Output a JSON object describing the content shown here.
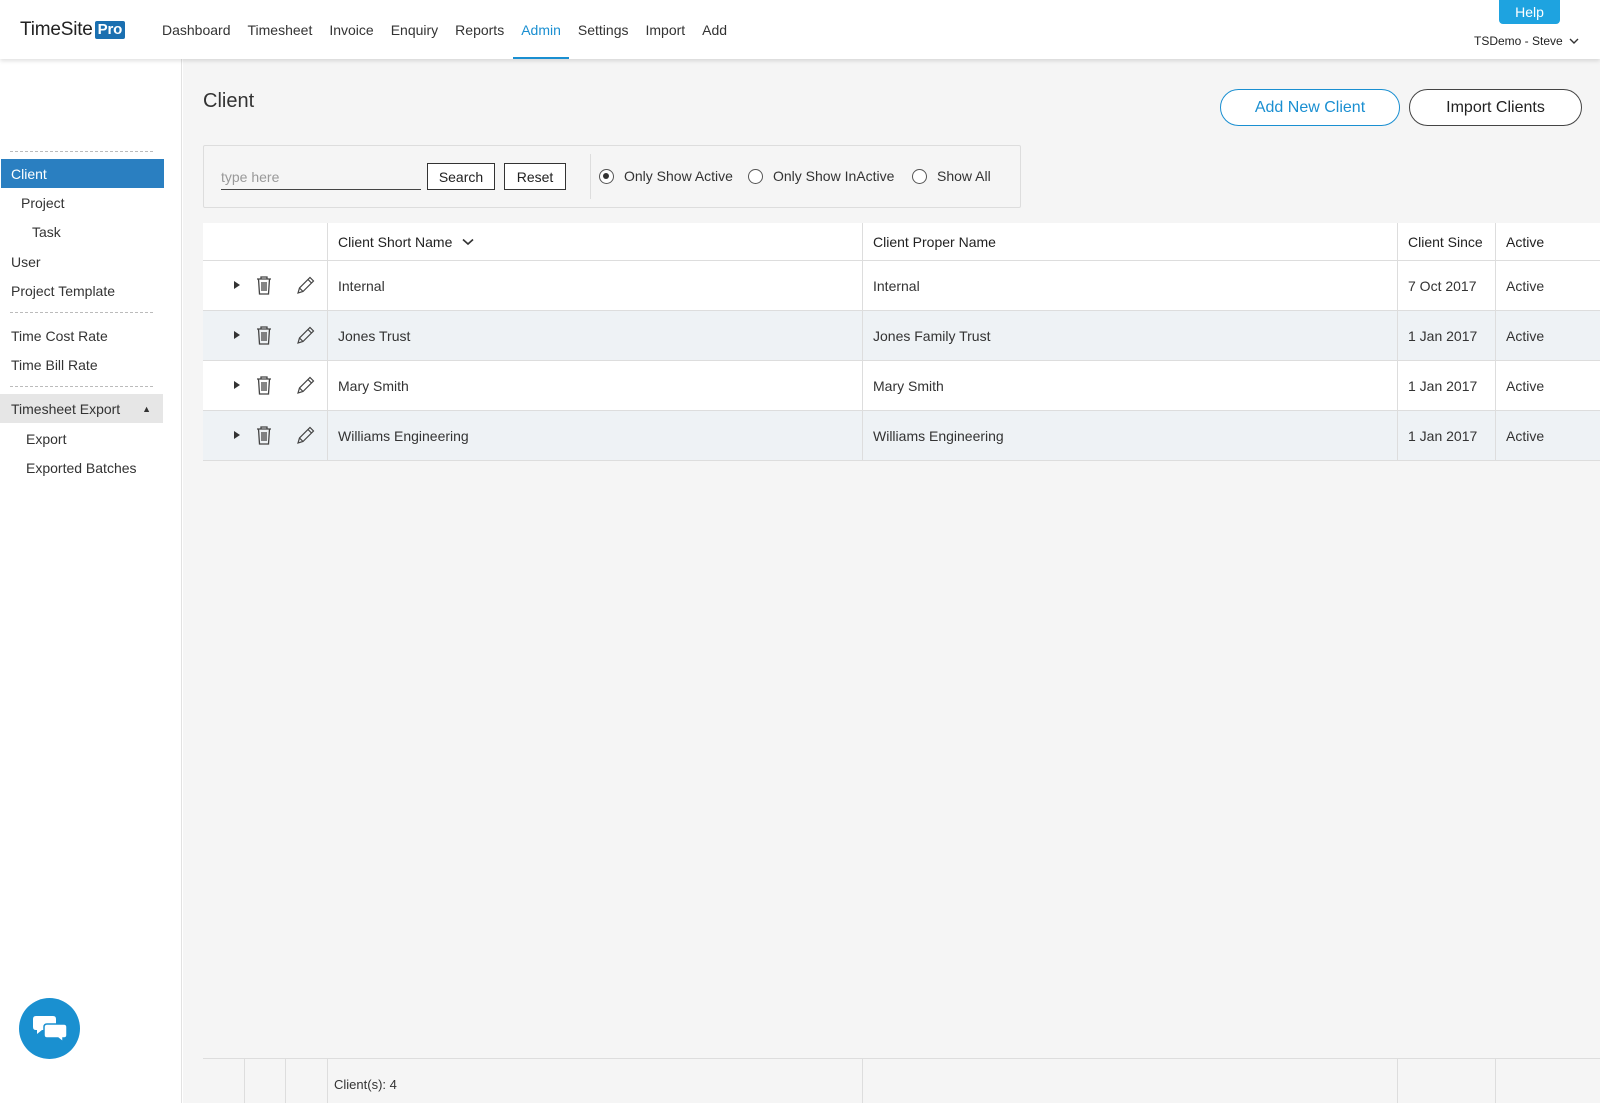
{
  "app": {
    "logo_text": "TimeSite",
    "logo_badge": "Pro"
  },
  "nav": {
    "items": [
      {
        "label": "Dashboard"
      },
      {
        "label": "Timesheet"
      },
      {
        "label": "Invoice"
      },
      {
        "label": "Enquiry"
      },
      {
        "label": "Reports"
      },
      {
        "label": "Admin"
      },
      {
        "label": "Settings"
      },
      {
        "label": "Import"
      },
      {
        "label": "Add"
      }
    ],
    "active": "Admin",
    "help_label": "Help",
    "user_label": "TSDemo - Steve"
  },
  "sidebar": {
    "items": [
      {
        "label": "Client"
      },
      {
        "label": "Project"
      },
      {
        "label": "Task"
      },
      {
        "label": "User"
      },
      {
        "label": "Project Template"
      },
      {
        "label": "Time Cost Rate"
      },
      {
        "label": "Time Bill Rate"
      },
      {
        "label": "Timesheet Export"
      },
      {
        "label": "Export"
      },
      {
        "label": "Exported Batches"
      }
    ]
  },
  "page": {
    "title": "Client",
    "add_button": "Add New Client",
    "import_button": "Import Clients"
  },
  "filter": {
    "search_placeholder": "type here",
    "search_value": "",
    "search_button": "Search",
    "reset_button": "Reset",
    "options": [
      {
        "label": "Only Show Active",
        "checked": true
      },
      {
        "label": "Only Show InActive",
        "checked": false
      },
      {
        "label": "Show All",
        "checked": false
      }
    ]
  },
  "grid": {
    "columns": {
      "short_name": "Client Short Name",
      "proper_name": "Client Proper Name",
      "since": "Client Since",
      "active": "Active"
    },
    "rows": [
      {
        "short_name": "Internal",
        "proper_name": "Internal",
        "since": "7 Oct 2017",
        "active": "Active"
      },
      {
        "short_name": "Jones Trust",
        "proper_name": "Jones Family Trust",
        "since": "1 Jan 2017",
        "active": "Active"
      },
      {
        "short_name": "Mary Smith",
        "proper_name": "Mary Smith",
        "since": "1 Jan 2017",
        "active": "Active"
      },
      {
        "short_name": "Williams Engineering",
        "proper_name": "Williams Engineering",
        "since": "1 Jan 2017",
        "active": "Active"
      }
    ],
    "footer": "Client(s): 4"
  },
  "colors": {
    "accent": "#1a8fd1",
    "sidebar_active": "#2a7fc1",
    "help": "#1ea3e0"
  },
  "icons": {
    "trash": "trash-icon",
    "edit": "pencil-icon",
    "expand": "expand-arrow-icon",
    "chat": "chat-icon"
  }
}
